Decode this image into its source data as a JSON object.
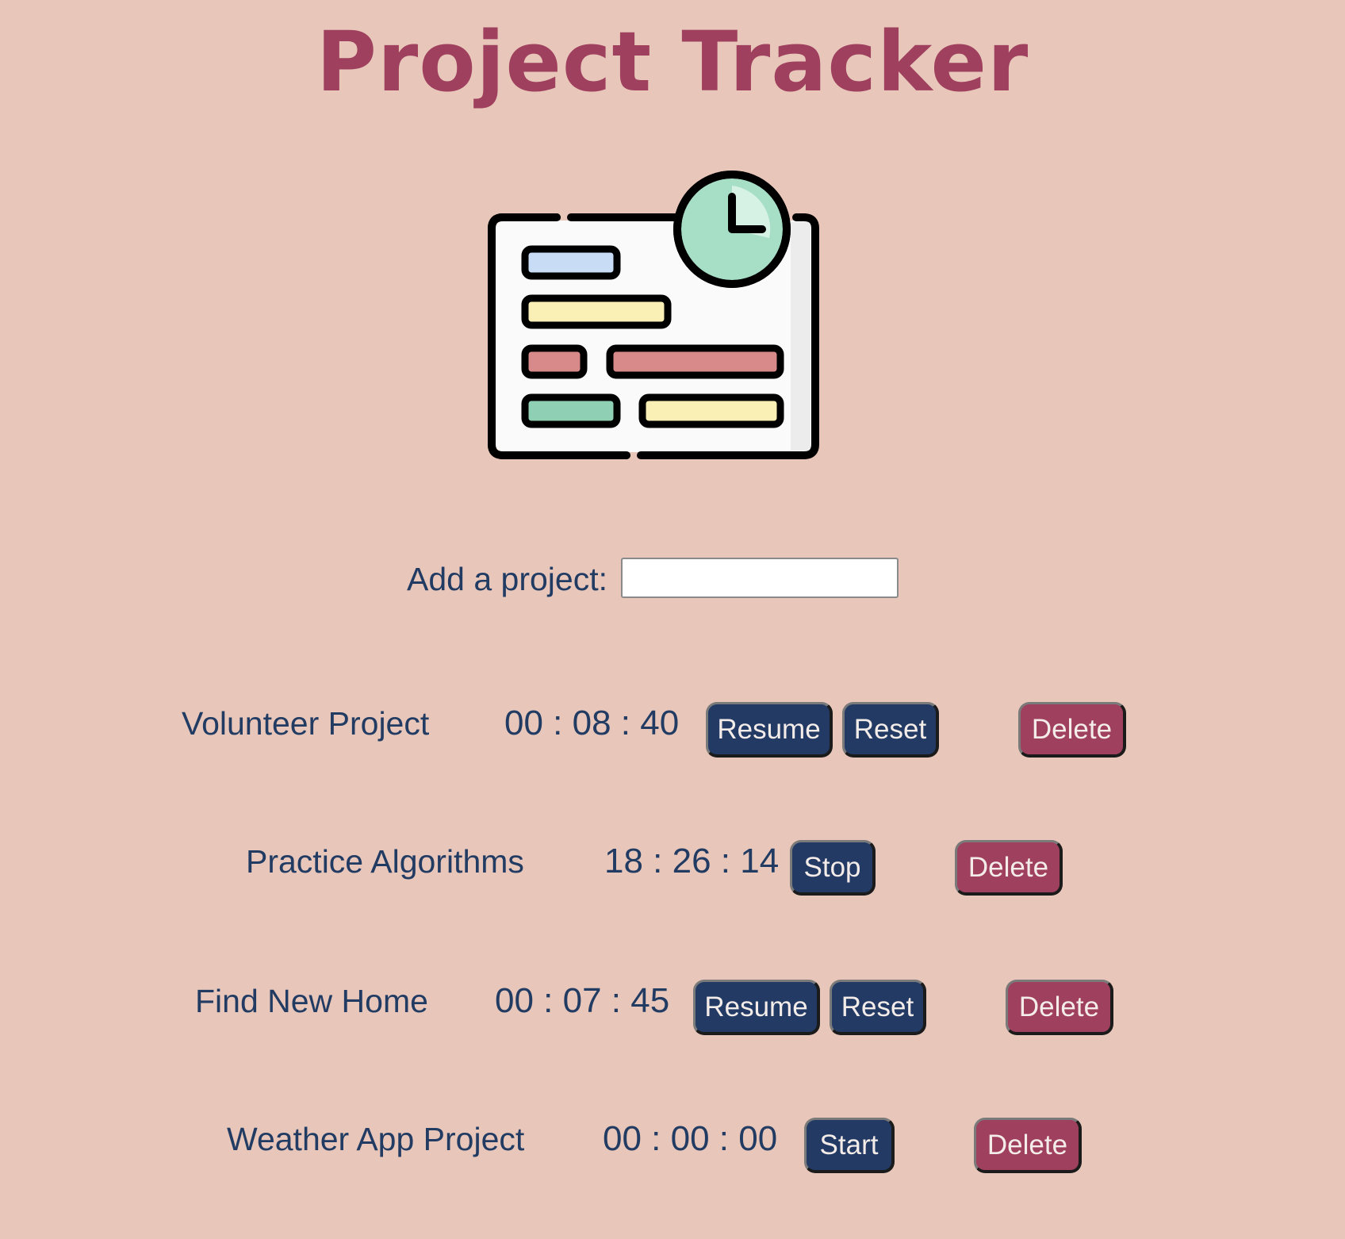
{
  "header": {
    "title": "Project Tracker"
  },
  "hero": {
    "icon": "project-board-clock-illustration"
  },
  "add_project": {
    "label": "Add a project:",
    "value": "",
    "placeholder": ""
  },
  "projects": [
    {
      "name": "Volunteer Project",
      "time": "00 : 08 : 40",
      "primary_label": "Resume",
      "secondary_label": "Reset",
      "delete_label": "Delete"
    },
    {
      "name": "Practice Algorithms",
      "time": "18 : 26 : 14",
      "primary_label": "Stop",
      "delete_label": "Delete"
    },
    {
      "name": "Find New Home",
      "time": "00 : 07 : 45",
      "primary_label": "Resume",
      "secondary_label": "Reset",
      "delete_label": "Delete"
    },
    {
      "name": "Weather App Project",
      "time": "00 : 00 : 00",
      "primary_label": "Start",
      "delete_label": "Delete"
    }
  ],
  "colors": {
    "background": "#e8c7ba",
    "title": "#a0405f",
    "text": "#213b63",
    "button_primary": "#223a64",
    "button_delete": "#a0405f"
  }
}
